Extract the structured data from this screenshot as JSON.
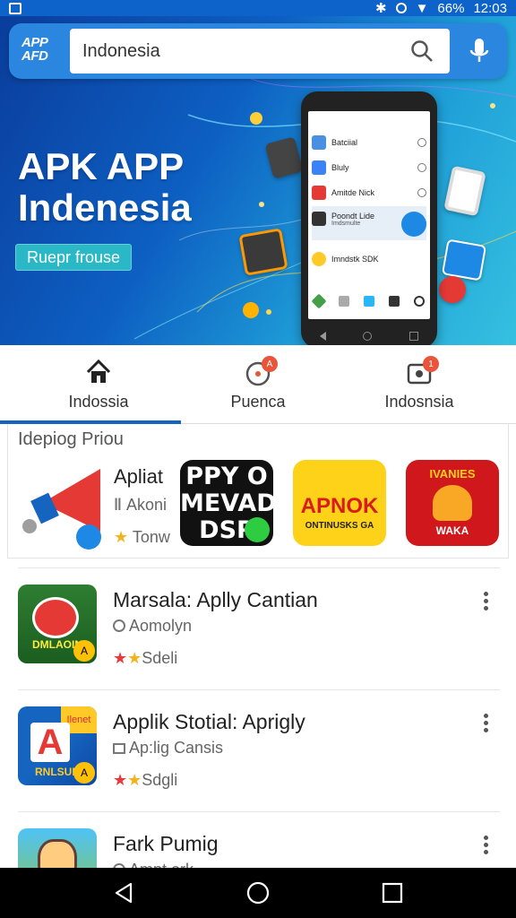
{
  "status_bar": {
    "battery": "66%",
    "time": "12:03"
  },
  "search": {
    "logo": "APP AFD",
    "value": "Indonesia"
  },
  "hero": {
    "title_line1": "APK APP",
    "title_line2": "Indenesia",
    "button": "Ruepr frouse",
    "phone_rows": [
      "Batciial",
      "Bluly",
      "Amitde Nick",
      "Poondt Lide",
      "Imndstk SDK"
    ],
    "phone_row_subs": [
      "",
      "",
      "",
      "Imdsmulte",
      ""
    ]
  },
  "tabs": [
    {
      "label": "Indossia",
      "badge": ""
    },
    {
      "label": "Puenca",
      "badge": "A"
    },
    {
      "label": "Indosnsia",
      "badge": "1"
    }
  ],
  "featured": {
    "section_title": "Idepiog Priou",
    "app_name": "Apliat",
    "developer": "Akoni",
    "rating_label": "Tonw",
    "tiles": [
      {
        "text": "PPY O MEVAD DSP"
      },
      {
        "text": "APNOK",
        "sub": "ONTINUSKS GA"
      },
      {
        "text": "IVANIES",
        "sub": "WAKA"
      }
    ]
  },
  "list": [
    {
      "title": "Marsala: Aplly Cantian",
      "subtitle": "Aomolyn",
      "rating_label": "Sdeli",
      "icon_text": "DMLAOIN",
      "icon_badge": "A"
    },
    {
      "title": "Applik Stotial: Aprigly",
      "subtitle": "Ap:lig Cansis",
      "rating_label": "Sdgli",
      "icon_text": "RNLSUN",
      "icon_badge": "A",
      "icon_top": "Ilenet"
    },
    {
      "title": "Fark Pumig",
      "subtitle": "Ampt ork",
      "rating_label": ""
    }
  ],
  "colors": {
    "brand": "#0d63c9",
    "accent": "#1565c0",
    "badge": "#e8553a",
    "star": "#f2b41e"
  }
}
